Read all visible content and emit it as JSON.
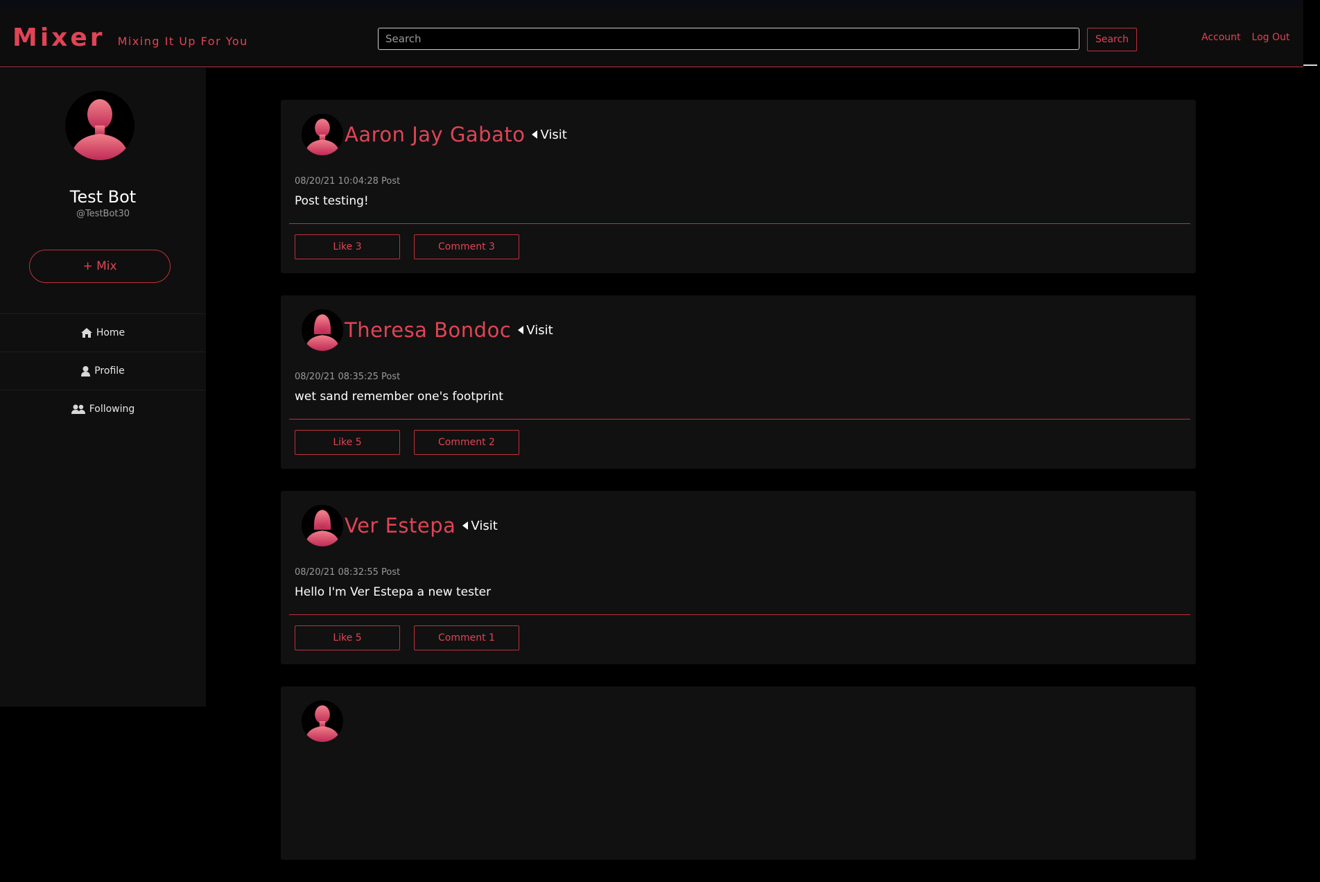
{
  "header": {
    "brand_title": "Mixer",
    "brand_subtitle": "Mixing It Up For You",
    "search_placeholder": "Search",
    "search_button": "Search",
    "account_link": "Account",
    "logout_link": "Log Out"
  },
  "sidebar": {
    "user_name": "Test Bot",
    "user_handle": "@TestBot30",
    "mix_button": "+ Mix",
    "nav": [
      {
        "label": "Home",
        "icon": "home-icon"
      },
      {
        "label": "Profile",
        "icon": "user-icon"
      },
      {
        "label": "Following",
        "icon": "users-icon"
      }
    ]
  },
  "posts": [
    {
      "author": "Aaron Jay Gabato",
      "visit_label": "Visit",
      "timestamp": "08/20/21 10:04:28",
      "type_label": "Post",
      "text": "Post testing!",
      "like_label": "Like 3",
      "comment_label": "Comment 3",
      "avatar": "male"
    },
    {
      "author": "Theresa Bondoc",
      "visit_label": "Visit",
      "timestamp": "08/20/21 08:35:25",
      "type_label": "Post",
      "text": "wet sand remember one's footprint",
      "like_label": "Like 5",
      "comment_label": "Comment 2",
      "avatar": "female"
    },
    {
      "author": "Ver Estepa",
      "visit_label": "Visit",
      "timestamp": "08/20/21 08:32:55",
      "type_label": "Post",
      "text": "Hello I'm Ver Estepa a new tester",
      "like_label": "Like 5",
      "comment_label": "Comment 1",
      "avatar": "female"
    }
  ],
  "colors": {
    "accent": "#e04455",
    "border_accent": "#c0303d",
    "background": "#000000",
    "panel": "#111111"
  }
}
